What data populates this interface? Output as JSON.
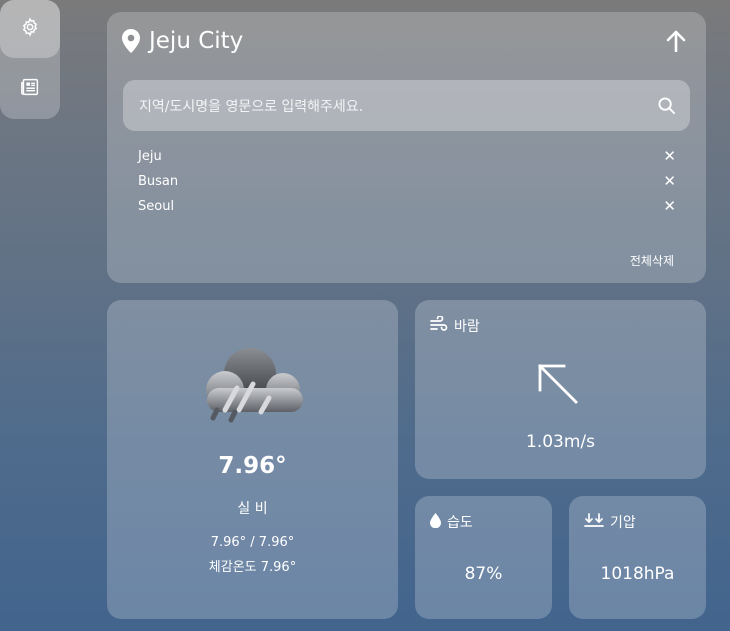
{
  "sidebar": {
    "items": [
      {
        "icon": "gear-icon",
        "active": true
      },
      {
        "icon": "newspaper-icon",
        "active": false
      }
    ]
  },
  "location": {
    "city": "Jeju City"
  },
  "search": {
    "placeholder": "지역/도시명을 영문으로 입력해주세요."
  },
  "history": {
    "items": [
      "Jeju",
      "Busan",
      "Seoul"
    ],
    "remove_symbol": "✕",
    "clear_all_label": "전체삭제"
  },
  "weather": {
    "icon": "rain-cloud-icon",
    "temperature": "7.96°",
    "description": "실 비",
    "min_max": "7.96° / 7.96°",
    "feels_like": "체감온도 7.96°"
  },
  "wind": {
    "title": "바람",
    "direction_icon": "arrow-up-left-icon",
    "speed": "1.03m/s"
  },
  "humidity": {
    "title": "습도",
    "value": "87%"
  },
  "pressure": {
    "title": "기압",
    "value": "1018hPa"
  }
}
